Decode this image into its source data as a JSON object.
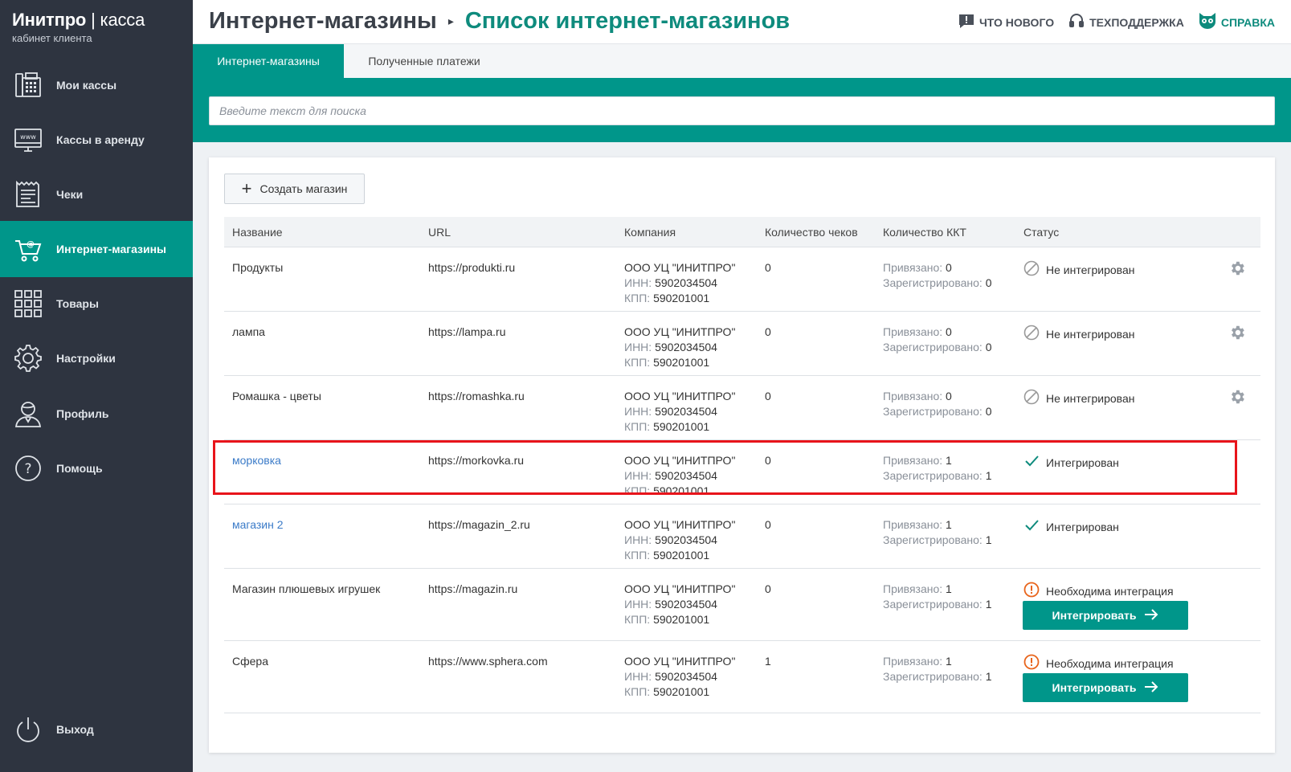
{
  "brand": {
    "title_bold": "Инитпро",
    "separator": "|",
    "title_light": "касса",
    "subtitle": "кабинет клиента"
  },
  "sidebar": {
    "items": [
      {
        "label": "Мои кассы",
        "icon": "cash-register-icon"
      },
      {
        "label": "Кассы в аренду",
        "icon": "www-monitor-icon"
      },
      {
        "label": "Чеки",
        "icon": "receipt-icon"
      },
      {
        "label": "Интернет-магазины",
        "icon": "shopping-cart-icon",
        "active": true
      },
      {
        "label": "Товары",
        "icon": "grid-icon"
      },
      {
        "label": "Настройки",
        "icon": "gear-icon"
      },
      {
        "label": "Профиль",
        "icon": "user-icon"
      },
      {
        "label": "Помощь",
        "icon": "question-icon"
      }
    ],
    "logout": {
      "label": "Выход",
      "icon": "power-icon"
    }
  },
  "header": {
    "crumb_parent": "Интернет-магазины",
    "crumb_current": "Список интернет-магазинов",
    "links": {
      "whats_new": "Что нового",
      "support": "Техподдержка",
      "help": "Справка"
    }
  },
  "tabs": {
    "shops": "Интернет-магазины",
    "payments": "Полученные платежи"
  },
  "search": {
    "placeholder": "Введите текст для поиска"
  },
  "create_button": "Создать магазин",
  "table": {
    "headers": {
      "name": "Название",
      "url": "URL",
      "company": "Компания",
      "checks": "Количество чеков",
      "kkt": "Количество ККТ",
      "status": "Статус"
    },
    "labels": {
      "inn": "ИНН:",
      "kpp": "КПП:",
      "bound": "Привязано:",
      "registered": "Зарегистрировано:",
      "integrate_btn": "Интегрировать"
    },
    "rows": [
      {
        "name": "Продукты",
        "url": "https://produkti.ru",
        "company": "ООО УЦ \"ИНИТПРО\"",
        "inn": "5902034504",
        "kpp": "590201001",
        "checks": "0",
        "bound": "0",
        "registered": "0",
        "status": "Не интегрирован",
        "status_type": "not",
        "link": false
      },
      {
        "name": "лампа",
        "url": "https://lampa.ru",
        "company": "ООО УЦ \"ИНИТПРО\"",
        "inn": "5902034504",
        "kpp": "590201001",
        "checks": "0",
        "bound": "0",
        "registered": "0",
        "status": "Не интегрирован",
        "status_type": "not",
        "link": false
      },
      {
        "name": "Ромашка - цветы",
        "url": "https://romashka.ru",
        "company": "ООО УЦ \"ИНИТПРО\"",
        "inn": "5902034504",
        "kpp": "590201001",
        "checks": "0",
        "bound": "0",
        "registered": "0",
        "status": "Не интегрирован",
        "status_type": "not",
        "link": false
      },
      {
        "name": "морковка",
        "url": "https://morkovka.ru",
        "company": "ООО УЦ \"ИНИТПРО\"",
        "inn": "5902034504",
        "kpp": "590201001",
        "checks": "0",
        "bound": "1",
        "registered": "1",
        "status": "Интегрирован",
        "status_type": "ok",
        "link": true
      },
      {
        "name": "магазин 2",
        "url": "https://magazin_2.ru",
        "company": "ООО УЦ \"ИНИТПРО\"",
        "inn": "5902034504",
        "kpp": "590201001",
        "checks": "0",
        "bound": "1",
        "registered": "1",
        "status": "Интегрирован",
        "status_type": "ok",
        "link": true
      },
      {
        "name": "Магазин плюшевых игрушек",
        "url": "https://magazin.ru",
        "company": "ООО УЦ \"ИНИТПРО\"",
        "inn": "5902034504",
        "kpp": "590201001",
        "checks": "0",
        "bound": "1",
        "registered": "1",
        "status": "Необходима интеграция",
        "status_type": "need",
        "link": false
      },
      {
        "name": "Сфера",
        "url": "https://www.sphera.com",
        "company": "ООО УЦ \"ИНИТПРО\"",
        "inn": "5902034504",
        "kpp": "590201001",
        "checks": "1",
        "bound": "1",
        "registered": "1",
        "status": "Необходима интеграция",
        "status_type": "need",
        "link": false
      }
    ]
  },
  "colors": {
    "sidebar_bg": "#2e3440",
    "accent": "#00968a",
    "link": "#3b7bc8",
    "warning": "#e8641b",
    "highlight": "#e8141b"
  }
}
